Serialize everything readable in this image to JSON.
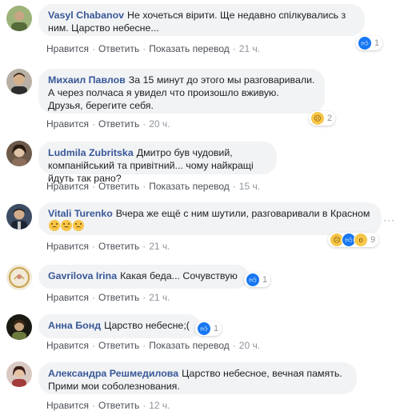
{
  "actions": {
    "like": "Нравится",
    "reply": "Ответить",
    "translate": "Показать перевод",
    "sep": "·"
  },
  "more_icon_label": "···",
  "colors": {
    "author": "#385898",
    "bubble": "#f2f3f5",
    "like": "#1877f2",
    "sad": "#f7c648"
  },
  "comments": [
    {
      "author": "Vasyl Chabanov",
      "text": "Не хочеться вірити. Ще недавно спілкувались з ним. Царство небесне...",
      "time": "21 ч.",
      "translate": true,
      "reactions": {
        "icons": [
          "like-icon"
        ],
        "count": "1"
      }
    },
    {
      "author": "Михаил Павлов",
      "text": "За 15 минут до этого мы разговаривали. А через полчаса я увидел что произошло вживую. Друзья, берегите себя.",
      "time": "20 ч.",
      "translate": false,
      "reactions": {
        "icons": [
          "sad-icon"
        ],
        "count": "2"
      }
    },
    {
      "author": "Ludmila Zubritska",
      "text": "Дмитро був чудовий, компанійський та привітний... чому найкращі йдуть так рано?",
      "time": "15 ч.",
      "translate": true,
      "reactions": null
    },
    {
      "author": "Vitali Turenko",
      "text": "Вчера же ещё с ним шутили, разговаривали в Красном",
      "text_emojis": [
        "sad-emoji",
        "sad-emoji",
        "sad-emoji"
      ],
      "time": "21 ч.",
      "translate": false,
      "reactions": {
        "icons": [
          "sad-icon",
          "like-icon",
          "wow-icon"
        ],
        "count": "9"
      }
    },
    {
      "author": "Gavrilova Irina",
      "text": "Какая беда... Сочувствую",
      "time": "21 ч.",
      "translate": false,
      "reactions": {
        "icons": [
          "like-icon"
        ],
        "count": "1"
      }
    },
    {
      "author": "Анна Бонд",
      "text": "Царство небесне;(",
      "time": "20 ч.",
      "translate": true,
      "reactions": {
        "icons": [
          "like-icon"
        ],
        "count": "1"
      }
    },
    {
      "author": "Александра Решмедилова",
      "text": "Царство небесное, вечная память. Прими мои соболезнования.",
      "time": "12 ч.",
      "translate": false,
      "reactions": null
    }
  ]
}
